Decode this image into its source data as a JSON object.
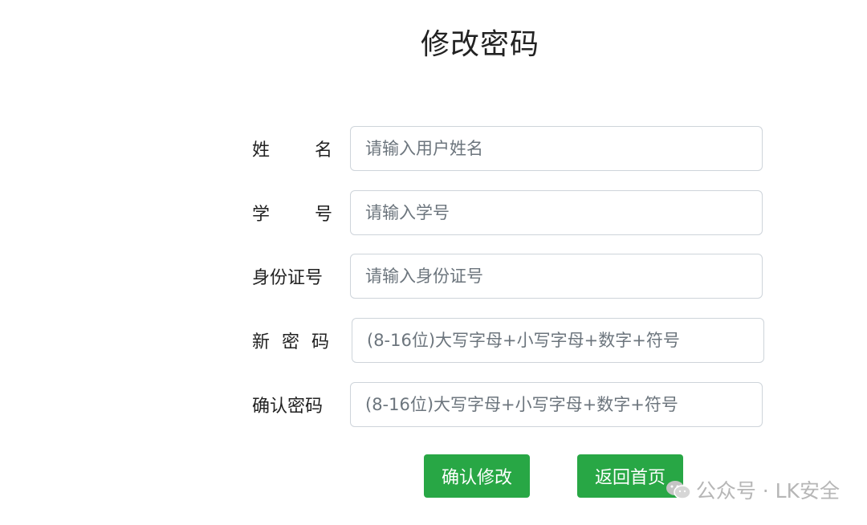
{
  "page": {
    "title": "修改密码"
  },
  "form": {
    "fields": [
      {
        "label_chars": [
          "姓",
          "名"
        ],
        "placeholder": "请输入用户姓名"
      },
      {
        "label_chars": [
          "学",
          "号"
        ],
        "placeholder": "请输入学号"
      },
      {
        "label": "身份证号",
        "placeholder": "请输入身份证号"
      },
      {
        "label_chars": [
          "新",
          "密",
          "码"
        ],
        "placeholder": "(8-16位)大写字母+小写字母+数字+符号"
      },
      {
        "label": "确认密码",
        "placeholder": "(8-16位)大写字母+小写字母+数字+符号"
      }
    ]
  },
  "buttons": {
    "confirm_label": "确认修改",
    "home_label": "返回首页"
  },
  "colors": {
    "button_bg": "#28a745",
    "input_border": "#ced4da"
  },
  "watermark": {
    "icon": "wechat-icon",
    "text": "公众号 · LK安全"
  }
}
